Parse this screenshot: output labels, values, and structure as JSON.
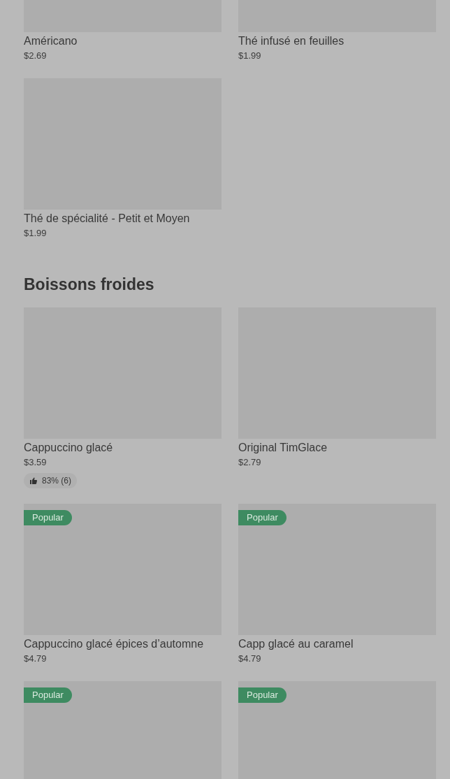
{
  "sections": [
    {
      "items": [
        {
          "name": "Américano",
          "price": "$2.69"
        },
        {
          "name": "Thé infusé en feuilles",
          "price": "$1.99"
        },
        {
          "name": "Thé de spécialité - Petit et Moyen",
          "price": "$1.99"
        }
      ]
    },
    {
      "title": "Boissons froides",
      "items": [
        {
          "name": "Cappuccino glacé",
          "price": "$3.59",
          "rating": "83% (6)"
        },
        {
          "name": "Original TimGlace",
          "price": "$2.79"
        },
        {
          "name": "Cappuccino glacé épices d’automne",
          "price": "$4.79",
          "badge": "Popular"
        },
        {
          "name": "Capp glacé au caramel",
          "price": "$4.79",
          "badge": "Popular"
        },
        {
          "badge": "Popular"
        },
        {
          "badge": "Popular"
        }
      ]
    }
  ]
}
